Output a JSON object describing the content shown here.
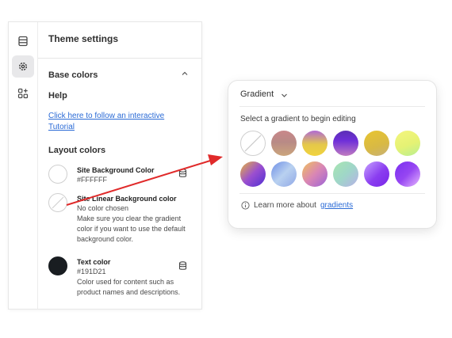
{
  "sidebar": {
    "header": "Theme settings",
    "section_title": "Base colors",
    "help_label": "Help",
    "help_link": "Click here to follow an interactive Tutorial",
    "layout_label": "Layout colors",
    "items": [
      {
        "title": "Site Background Color",
        "value": "#FFFFFF"
      },
      {
        "title": "Site Linear Background color",
        "value": "No color chosen",
        "description": "Make sure you clear the gradient color if you want to use the default background color."
      },
      {
        "title": "Text color",
        "value": "#191D21",
        "description": "Color used for content such as product names and descriptions."
      }
    ]
  },
  "popup": {
    "title": "Gradient",
    "subtitle": "Select a gradient to begin editing",
    "info_prefix": "Learn more about",
    "info_link": "gradients"
  },
  "colors": {
    "link": "#2b6bd6",
    "arrow": "#e02a2a",
    "text_color_swatch": "#191D21"
  }
}
